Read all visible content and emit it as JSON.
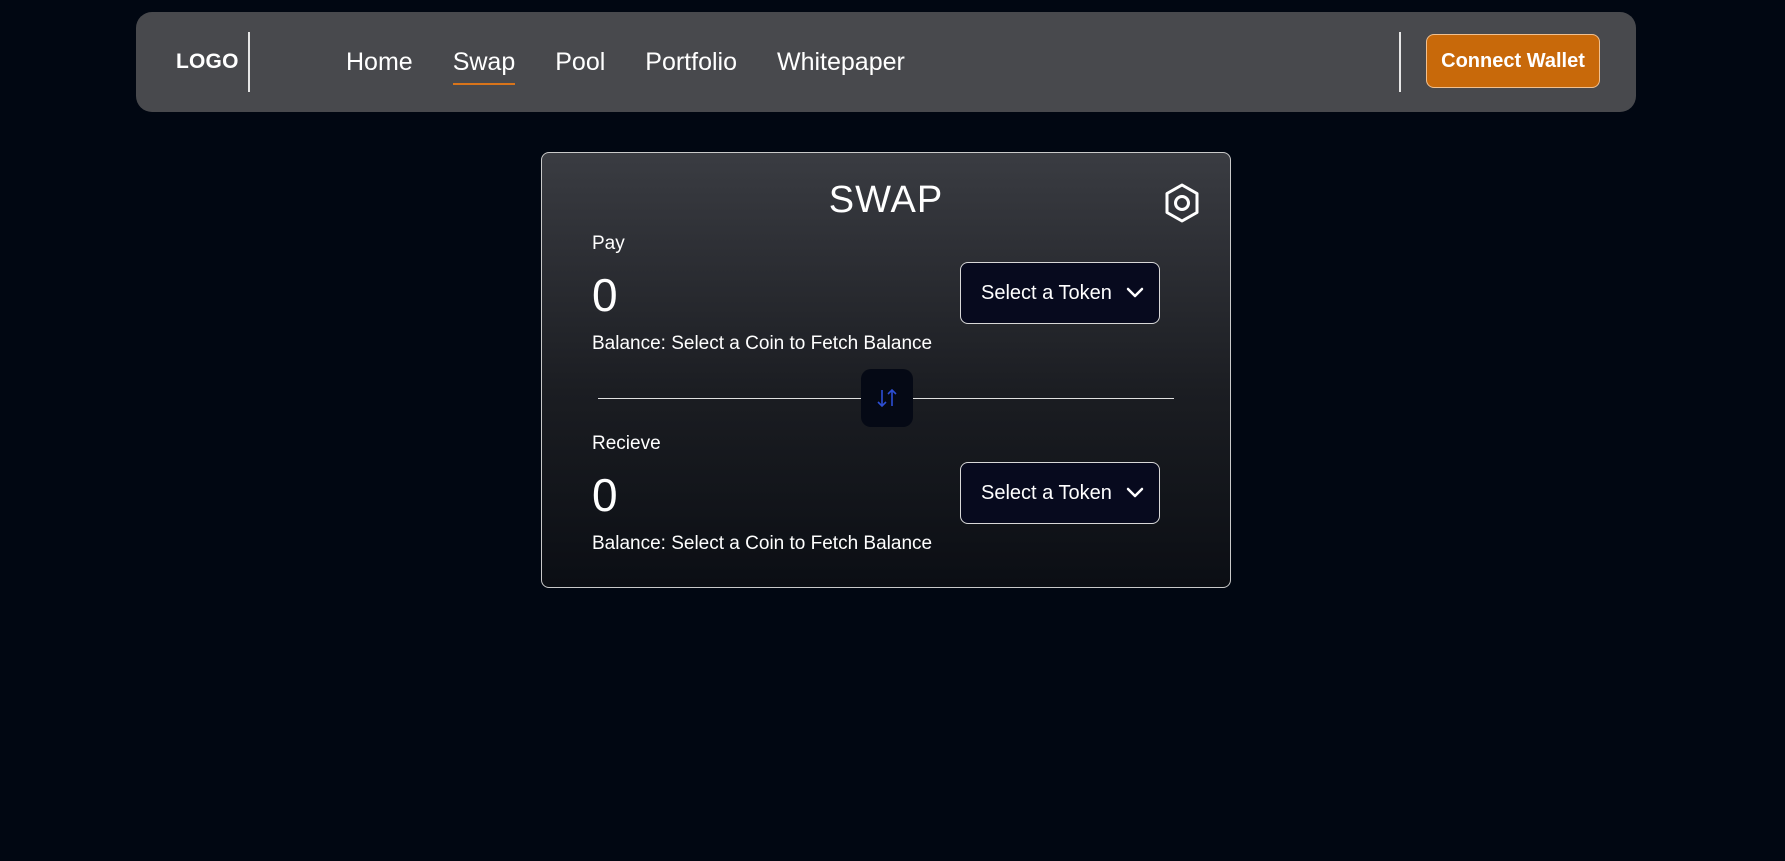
{
  "navbar": {
    "logo": "LOGO",
    "links": [
      "Home",
      "Swap",
      "Pool",
      "Portfolio",
      "Whitepaper"
    ],
    "active_link": "Swap",
    "connect_label": "Connect Wallet"
  },
  "swap": {
    "title": "SWAP",
    "settings_icon": "settings-hexagon-icon",
    "flip_icon": "swap-arrows-icon",
    "pay": {
      "label": "Pay",
      "amount": "0",
      "token_label": "Select a Token",
      "balance": "Balance: Select a Coin to Fetch Balance"
    },
    "receive": {
      "label": "Recieve",
      "amount": "0",
      "token_label": "Select a Token",
      "balance": "Balance: Select a Coin to Fetch Balance"
    }
  },
  "colors": {
    "background": "#010712",
    "navbar": "#48494d",
    "accent": "#c8690a",
    "active_underline": "#d9741a",
    "flip_arrow": "#2d4fd6"
  }
}
